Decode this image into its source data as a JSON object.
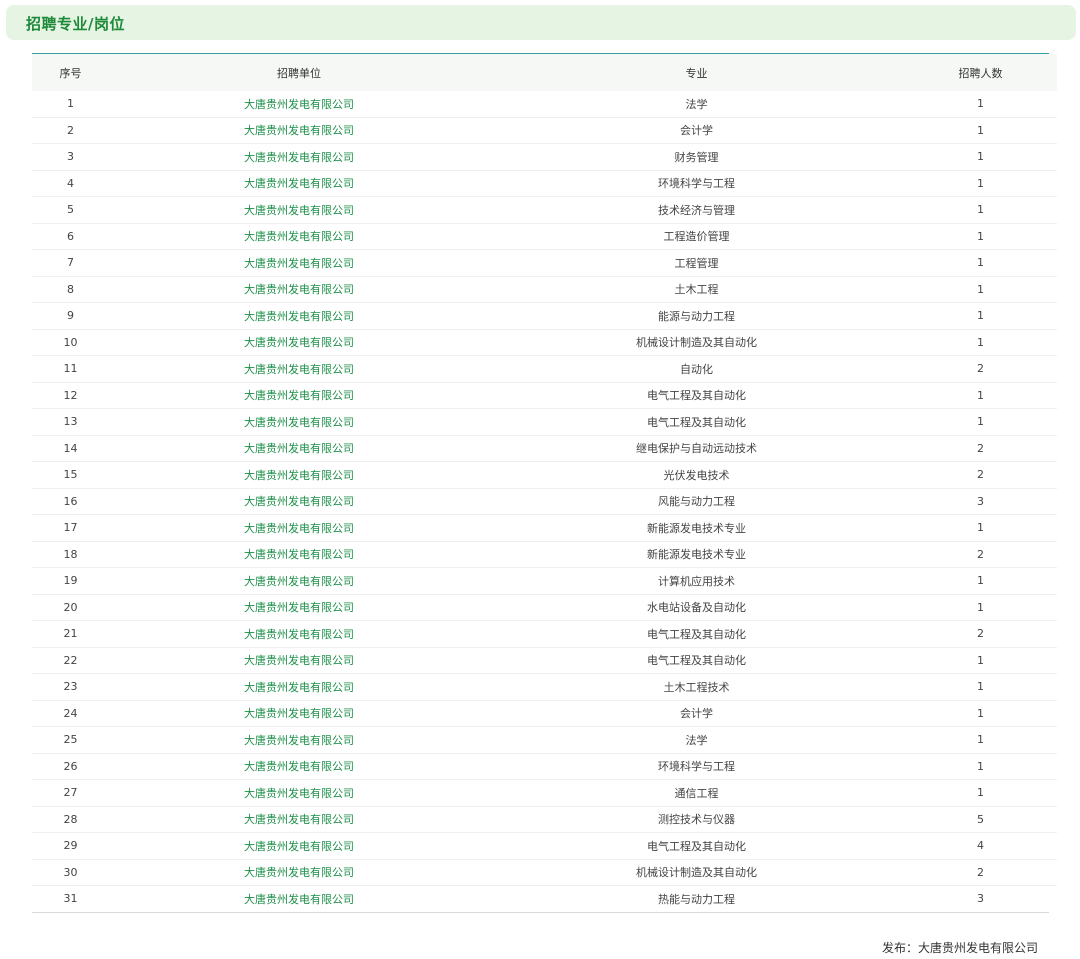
{
  "section": {
    "title": "招聘专业/岗位"
  },
  "table": {
    "headers": {
      "seq": "序号",
      "unit": "招聘单位",
      "major": "专业",
      "count": "招聘人数"
    },
    "rows": [
      {
        "seq": "1",
        "unit": "大唐贵州发电有限公司",
        "major": "法学",
        "count": "1"
      },
      {
        "seq": "2",
        "unit": "大唐贵州发电有限公司",
        "major": "会计学",
        "count": "1"
      },
      {
        "seq": "3",
        "unit": "大唐贵州发电有限公司",
        "major": "财务管理",
        "count": "1"
      },
      {
        "seq": "4",
        "unit": "大唐贵州发电有限公司",
        "major": "环境科学与工程",
        "count": "1"
      },
      {
        "seq": "5",
        "unit": "大唐贵州发电有限公司",
        "major": "技术经济与管理",
        "count": "1"
      },
      {
        "seq": "6",
        "unit": "大唐贵州发电有限公司",
        "major": "工程造价管理",
        "count": "1"
      },
      {
        "seq": "7",
        "unit": "大唐贵州发电有限公司",
        "major": "工程管理",
        "count": "1"
      },
      {
        "seq": "8",
        "unit": "大唐贵州发电有限公司",
        "major": "土木工程",
        "count": "1"
      },
      {
        "seq": "9",
        "unit": "大唐贵州发电有限公司",
        "major": "能源与动力工程",
        "count": "1"
      },
      {
        "seq": "10",
        "unit": "大唐贵州发电有限公司",
        "major": "机械设计制造及其自动化",
        "count": "1"
      },
      {
        "seq": "11",
        "unit": "大唐贵州发电有限公司",
        "major": "自动化",
        "count": "2"
      },
      {
        "seq": "12",
        "unit": "大唐贵州发电有限公司",
        "major": "电气工程及其自动化",
        "count": "1"
      },
      {
        "seq": "13",
        "unit": "大唐贵州发电有限公司",
        "major": "电气工程及其自动化",
        "count": "1"
      },
      {
        "seq": "14",
        "unit": "大唐贵州发电有限公司",
        "major": "继电保护与自动远动技术",
        "count": "2"
      },
      {
        "seq": "15",
        "unit": "大唐贵州发电有限公司",
        "major": "光伏发电技术",
        "count": "2"
      },
      {
        "seq": "16",
        "unit": "大唐贵州发电有限公司",
        "major": "风能与动力工程",
        "count": "3"
      },
      {
        "seq": "17",
        "unit": "大唐贵州发电有限公司",
        "major": "新能源发电技术专业",
        "count": "1"
      },
      {
        "seq": "18",
        "unit": "大唐贵州发电有限公司",
        "major": "新能源发电技术专业",
        "count": "2"
      },
      {
        "seq": "19",
        "unit": "大唐贵州发电有限公司",
        "major": "计算机应用技术",
        "count": "1"
      },
      {
        "seq": "20",
        "unit": "大唐贵州发电有限公司",
        "major": "水电站设备及自动化",
        "count": "1"
      },
      {
        "seq": "21",
        "unit": "大唐贵州发电有限公司",
        "major": "电气工程及其自动化",
        "count": "2"
      },
      {
        "seq": "22",
        "unit": "大唐贵州发电有限公司",
        "major": "电气工程及其自动化",
        "count": "1"
      },
      {
        "seq": "23",
        "unit": "大唐贵州发电有限公司",
        "major": "土木工程技术",
        "count": "1"
      },
      {
        "seq": "24",
        "unit": "大唐贵州发电有限公司",
        "major": "会计学",
        "count": "1"
      },
      {
        "seq": "25",
        "unit": "大唐贵州发电有限公司",
        "major": "法学",
        "count": "1"
      },
      {
        "seq": "26",
        "unit": "大唐贵州发电有限公司",
        "major": "环境科学与工程",
        "count": "1"
      },
      {
        "seq": "27",
        "unit": "大唐贵州发电有限公司",
        "major": "通信工程",
        "count": "1"
      },
      {
        "seq": "28",
        "unit": "大唐贵州发电有限公司",
        "major": "测控技术与仪器",
        "count": "5"
      },
      {
        "seq": "29",
        "unit": "大唐贵州发电有限公司",
        "major": "电气工程及其自动化",
        "count": "4"
      },
      {
        "seq": "30",
        "unit": "大唐贵州发电有限公司",
        "major": "机械设计制造及其自动化",
        "count": "2"
      },
      {
        "seq": "31",
        "unit": "大唐贵州发电有限公司",
        "major": "热能与动力工程",
        "count": "3"
      }
    ]
  },
  "footer": {
    "publisher": "发布：大唐贵州发电有限公司"
  },
  "colors": {
    "accent": "#1f8a3a",
    "link": "#1d8f4a",
    "header_bg": "#e6f4e3",
    "rule": "#3aa0a8"
  }
}
